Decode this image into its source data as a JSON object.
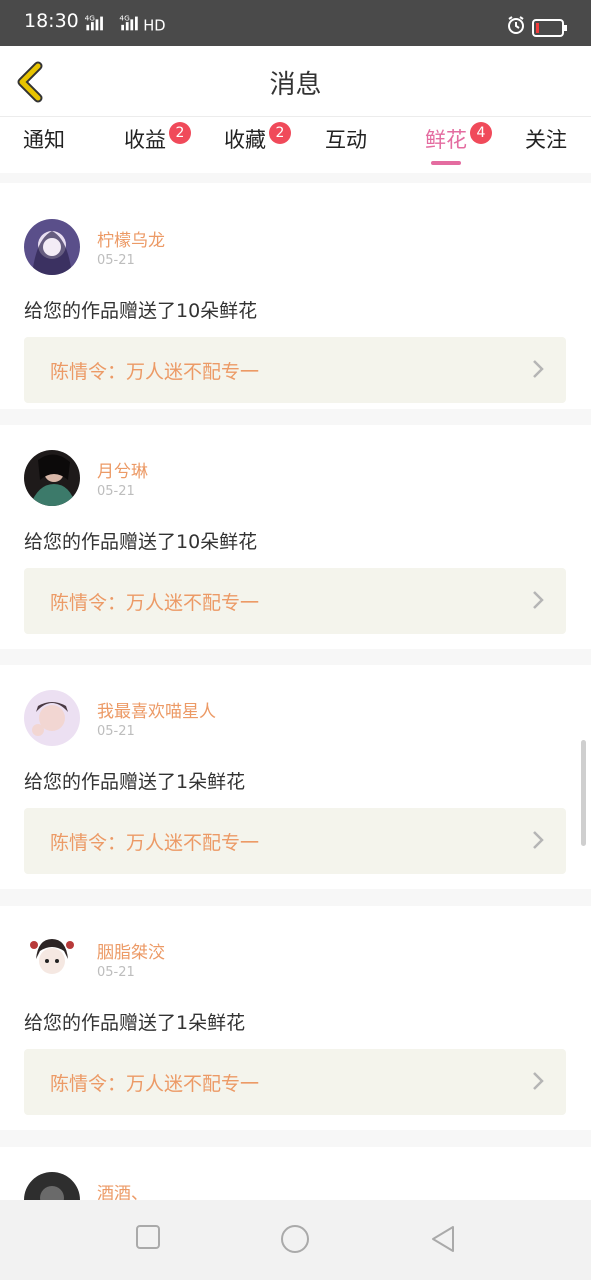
{
  "status_bar": {
    "time": "18:30",
    "network": "4G 4G HD"
  },
  "header": {
    "title": "消息",
    "back_icon": "chevron-left-icon",
    "accent": "#e8c400"
  },
  "tabs": [
    {
      "label": "通知",
      "badge": ""
    },
    {
      "label": "收益",
      "badge": "2"
    },
    {
      "label": "收藏",
      "badge": "2"
    },
    {
      "label": "互动",
      "badge": ""
    },
    {
      "label": "鲜花",
      "badge": "4",
      "active": true
    },
    {
      "label": "关注",
      "badge": ""
    }
  ],
  "colors": {
    "active_tab": "#e46ca0",
    "badge": "#f04a5a",
    "username": "#ec9a66",
    "work_bg": "#f4f4ec"
  },
  "messages": [
    {
      "username": "柠檬乌龙",
      "date": "05-21",
      "text": "给您的作品赠送了10朵鲜花",
      "work": "陈情令：万人迷不配专一"
    },
    {
      "username": "月兮琳",
      "date": "05-21",
      "text": "给您的作品赠送了10朵鲜花",
      "work": "陈情令：万人迷不配专一"
    },
    {
      "username": "我最喜欢喵星人",
      "date": "05-21",
      "text": "给您的作品赠送了1朵鲜花",
      "work": "陈情令：万人迷不配专一"
    },
    {
      "username": "胭脂桀洨",
      "date": "05-21",
      "text": "给您的作品赠送了1朵鲜花",
      "work": "陈情令：万人迷不配专一"
    },
    {
      "username": "酒酒、",
      "date": "",
      "text": "",
      "work": ""
    }
  ]
}
